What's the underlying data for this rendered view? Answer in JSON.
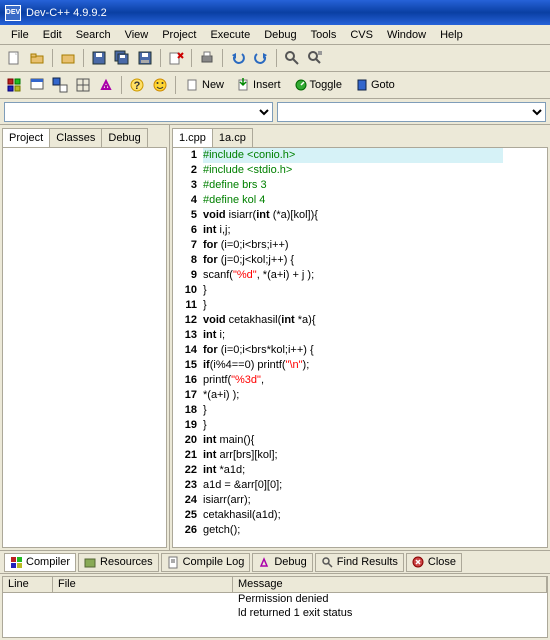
{
  "title": "Dev-C++ 4.9.9.2",
  "titleIcon": "DEV",
  "menu": [
    "File",
    "Edit",
    "Search",
    "View",
    "Project",
    "Execute",
    "Debug",
    "Tools",
    "CVS",
    "Window",
    "Help"
  ],
  "textButtons": {
    "new": "New",
    "insert": "Insert",
    "toggle": "Toggle",
    "goto": "Goto"
  },
  "leftTabs": [
    "Project",
    "Classes",
    "Debug"
  ],
  "fileTabs": [
    "1.cpp",
    "1a.cp"
  ],
  "code": [
    {
      "n": "1",
      "hl": true,
      "seg": [
        {
          "c": "pp",
          "t": "#include <conio.h>"
        }
      ]
    },
    {
      "n": "2",
      "seg": [
        {
          "c": "pp",
          "t": "#include <stdio.h>"
        }
      ]
    },
    {
      "n": "3",
      "seg": [
        {
          "c": "pp",
          "t": "#define brs 3"
        }
      ]
    },
    {
      "n": "4",
      "seg": [
        {
          "c": "pp",
          "t": "#define kol 4"
        }
      ]
    },
    {
      "n": "5",
      "seg": [
        {
          "c": "kw",
          "t": "void"
        },
        {
          "t": " isiarr("
        },
        {
          "c": "kw",
          "t": "int"
        },
        {
          "t": " (*a)[kol]){"
        }
      ]
    },
    {
      "n": "6",
      "seg": [
        {
          "c": "kw",
          "t": "int"
        },
        {
          "t": " i,j;"
        }
      ]
    },
    {
      "n": "7",
      "seg": [
        {
          "c": "kw",
          "t": "for"
        },
        {
          "t": " (i=0;i<brs;i++)"
        }
      ]
    },
    {
      "n": "8",
      "seg": [
        {
          "c": "kw",
          "t": "for"
        },
        {
          "t": " (j=0;j<kol;j++) {"
        }
      ]
    },
    {
      "n": "9",
      "seg": [
        {
          "t": "scanf("
        },
        {
          "c": "str",
          "t": "\"%d\""
        },
        {
          "t": ", *(a+i) + j );"
        }
      ]
    },
    {
      "n": "10",
      "seg": [
        {
          "t": "}"
        }
      ]
    },
    {
      "n": "11",
      "seg": [
        {
          "t": "}"
        }
      ]
    },
    {
      "n": "12",
      "seg": [
        {
          "c": "kw",
          "t": "void"
        },
        {
          "t": " cetakhasil("
        },
        {
          "c": "kw",
          "t": "int"
        },
        {
          "t": " *a){"
        }
      ]
    },
    {
      "n": "13",
      "seg": [
        {
          "c": "kw",
          "t": "int"
        },
        {
          "t": " i;"
        }
      ]
    },
    {
      "n": "14",
      "seg": [
        {
          "c": "kw",
          "t": "for"
        },
        {
          "t": " (i=0;i<brs*kol;i++) {"
        }
      ]
    },
    {
      "n": "15",
      "seg": [
        {
          "c": "kw",
          "t": "if"
        },
        {
          "t": "(i%4==0) printf("
        },
        {
          "c": "str",
          "t": "\"\\n\""
        },
        {
          "t": ");"
        }
      ]
    },
    {
      "n": "16",
      "seg": [
        {
          "t": "printf("
        },
        {
          "c": "str",
          "t": "\"%3d\""
        },
        {
          "t": ","
        }
      ]
    },
    {
      "n": "17",
      "seg": [
        {
          "t": "*(a+i) );"
        }
      ]
    },
    {
      "n": "18",
      "seg": [
        {
          "t": "}"
        }
      ]
    },
    {
      "n": "19",
      "seg": [
        {
          "t": "}"
        }
      ]
    },
    {
      "n": "20",
      "seg": [
        {
          "c": "kw",
          "t": "int"
        },
        {
          "t": " main(){"
        }
      ]
    },
    {
      "n": "21",
      "seg": [
        {
          "c": "kw",
          "t": "int"
        },
        {
          "t": " arr[brs][kol];"
        }
      ]
    },
    {
      "n": "22",
      "seg": [
        {
          "c": "kw",
          "t": "int"
        },
        {
          "t": " *a1d;"
        }
      ]
    },
    {
      "n": "23",
      "seg": [
        {
          "t": "a1d = &arr[0][0];"
        }
      ]
    },
    {
      "n": "24",
      "seg": [
        {
          "t": "isiarr(arr);"
        }
      ]
    },
    {
      "n": "25",
      "seg": [
        {
          "t": "cetakhasil(a1d);"
        }
      ]
    },
    {
      "n": "26",
      "seg": [
        {
          "t": "getch();"
        }
      ]
    }
  ],
  "bottomTabs": [
    "Compiler",
    "Resources",
    "Compile Log",
    "Debug",
    "Find Results",
    "Close"
  ],
  "msgCols": {
    "line": "Line",
    "file": "File",
    "message": "Message"
  },
  "messages": [
    {
      "line": "",
      "file": "",
      "msg": "Permission denied"
    },
    {
      "line": "",
      "file": "",
      "msg": "ld returned 1 exit status"
    }
  ]
}
